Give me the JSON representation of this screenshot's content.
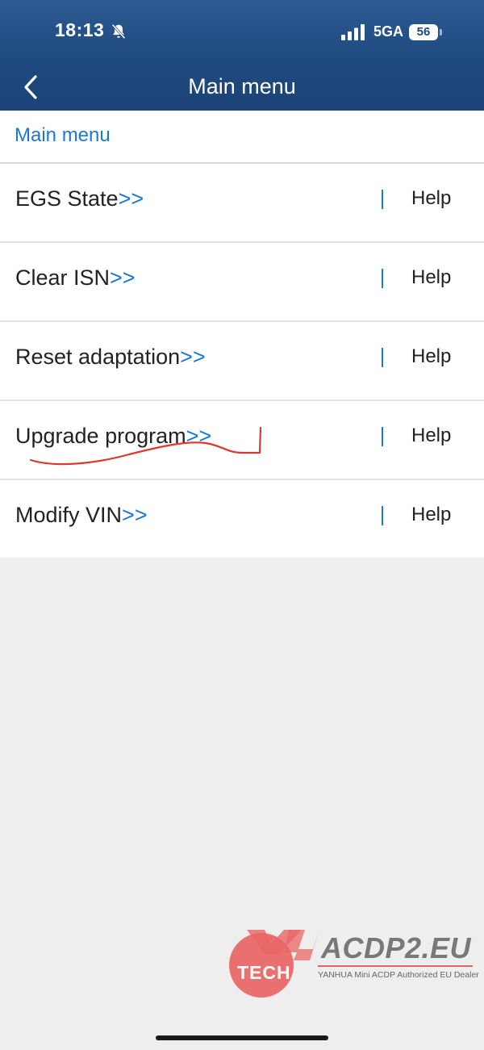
{
  "status_bar": {
    "time": "18:13",
    "silent_icon": "bell-slash-icon",
    "signal_icon": "signal-bars-icon",
    "network": "5GA",
    "battery": "56"
  },
  "nav": {
    "back_icon": "chevron-left-icon",
    "title": "Main menu"
  },
  "breadcrumb": "Main menu",
  "menu": {
    "arrow": ">>",
    "help_label": "Help",
    "items": [
      {
        "label": "EGS State"
      },
      {
        "label": "Clear ISN"
      },
      {
        "label": "Reset adaptation"
      },
      {
        "label": "Upgrade program"
      },
      {
        "label": "Modify VIN"
      }
    ]
  },
  "annotation": {
    "target": "Upgrade program",
    "color": "#e0362c"
  },
  "watermark": {
    "logo_text": "TECH",
    "site": "ACDP2.EU",
    "tagline": "YANHUA Mini ACDP Authorized EU Dealer"
  },
  "colors": {
    "header": "#1f4a80",
    "accent": "#1a78d6",
    "background": "#eeeeee"
  }
}
